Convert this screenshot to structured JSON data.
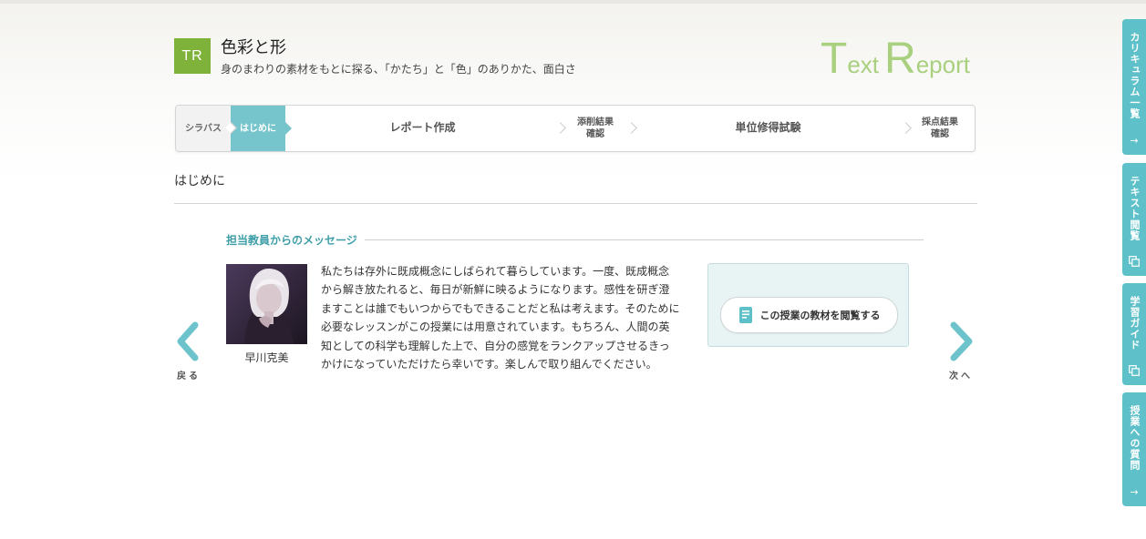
{
  "header": {
    "badge": "TR",
    "title": "色彩と形",
    "subtitle": "身のまわりの素材をもとに探る、「かたち」と「色」のありかた、面白さ",
    "logo": {
      "initial_1": "T",
      "rest_1": "ext",
      "initial_2": "R",
      "rest_2": "eport"
    }
  },
  "steps": [
    {
      "label": "シラバス"
    },
    {
      "label": "はじめに"
    },
    {
      "label": "レポート作成"
    },
    {
      "label": "添削結果\n確認"
    },
    {
      "label": "単位修得試験"
    },
    {
      "label": "採点結果\n確認"
    }
  ],
  "section_title": "はじめに",
  "message": {
    "heading": "担当教員からのメッセージ",
    "teacher_name": "早川克美",
    "body": "私たちは存外に既成概念にしばられて暮らしています。一度、既成概念から解き放たれると、毎日が新鮮に映るようになります。感性を研ぎ澄ますことは誰でもいつからでもできることだと私は考えます。そのために必要なレッスンがこの授業には用意されています。もちろん、人間の英知としての科学も理解した上で、自分の感覚をランクアップさせるきっかけになっていただけたら幸いです。楽しんで取り組んでください。"
  },
  "material_button": "この授業の教材を閲覧する",
  "nav": {
    "prev": "戻る",
    "next": "次へ"
  },
  "side_tabs": [
    {
      "label": "カリキュラム一覧",
      "icon": "arrow-right-icon"
    },
    {
      "label": "テキスト閲覧",
      "icon": "copy-icon"
    },
    {
      "label": "学習ガイド",
      "icon": "copy-icon"
    },
    {
      "label": "授業への質問",
      "icon": "arrow-right-icon"
    }
  ],
  "colors": {
    "accent": "#5ec0c9",
    "badge": "#7fb23a",
    "logo": "#9ccb6c",
    "heading": "#3e9ea8"
  }
}
